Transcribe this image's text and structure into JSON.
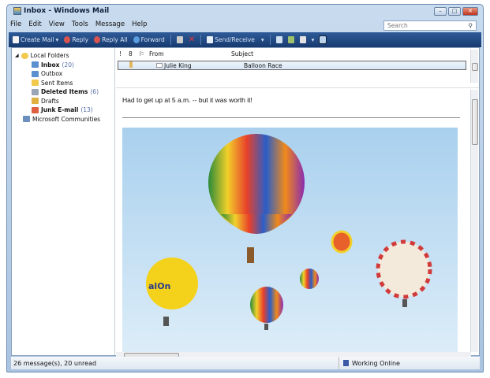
{
  "window": {
    "title": "Inbox - Windows Mail"
  },
  "menu": [
    "File",
    "Edit",
    "View",
    "Tools",
    "Message",
    "Help"
  ],
  "search": {
    "placeholder": "Search"
  },
  "toolbar": {
    "create_mail": "Create Mail",
    "reply": "Reply",
    "reply_all": "Reply All",
    "forward": "Forward",
    "send_receive": "Send/Receive"
  },
  "folders": [
    {
      "label": "Local Folders",
      "count": "",
      "bold": false,
      "color": "#f2c94c"
    },
    {
      "label": "Inbox",
      "count": "(20)",
      "bold": true,
      "color": "#5a8fd0"
    },
    {
      "label": "Outbox",
      "count": "",
      "bold": false,
      "color": "#5a8fd0"
    },
    {
      "label": "Sent Items",
      "count": "",
      "bold": false,
      "color": "#f2c94c"
    },
    {
      "label": "Deleted Items",
      "count": "(6)",
      "bold": true,
      "color": "#9aa6b5"
    },
    {
      "label": "Drafts",
      "count": "",
      "bold": false,
      "color": "#e0b040"
    },
    {
      "label": "Junk E-mail",
      "count": "(13)",
      "bold": true,
      "color": "#e06040"
    },
    {
      "label": "Microsoft Communities",
      "count": "",
      "bold": false,
      "color": "#6b8fbf"
    }
  ],
  "list": {
    "columns": {
      "importance": "!",
      "attachment": "8",
      "flag": "⚐",
      "from": "From",
      "subject": "Subject"
    },
    "rows": [
      {
        "from": "Julie King",
        "subject": "Balloon Race"
      }
    ]
  },
  "preview": {
    "body": "Had to get up at 5 a.m. -- but it was worth it!"
  },
  "status": {
    "count": "26 message(s), 20 unread",
    "online": "Working Online"
  },
  "colors": {
    "toolbar": "#1f4680",
    "sky": "#c9e2f4"
  }
}
